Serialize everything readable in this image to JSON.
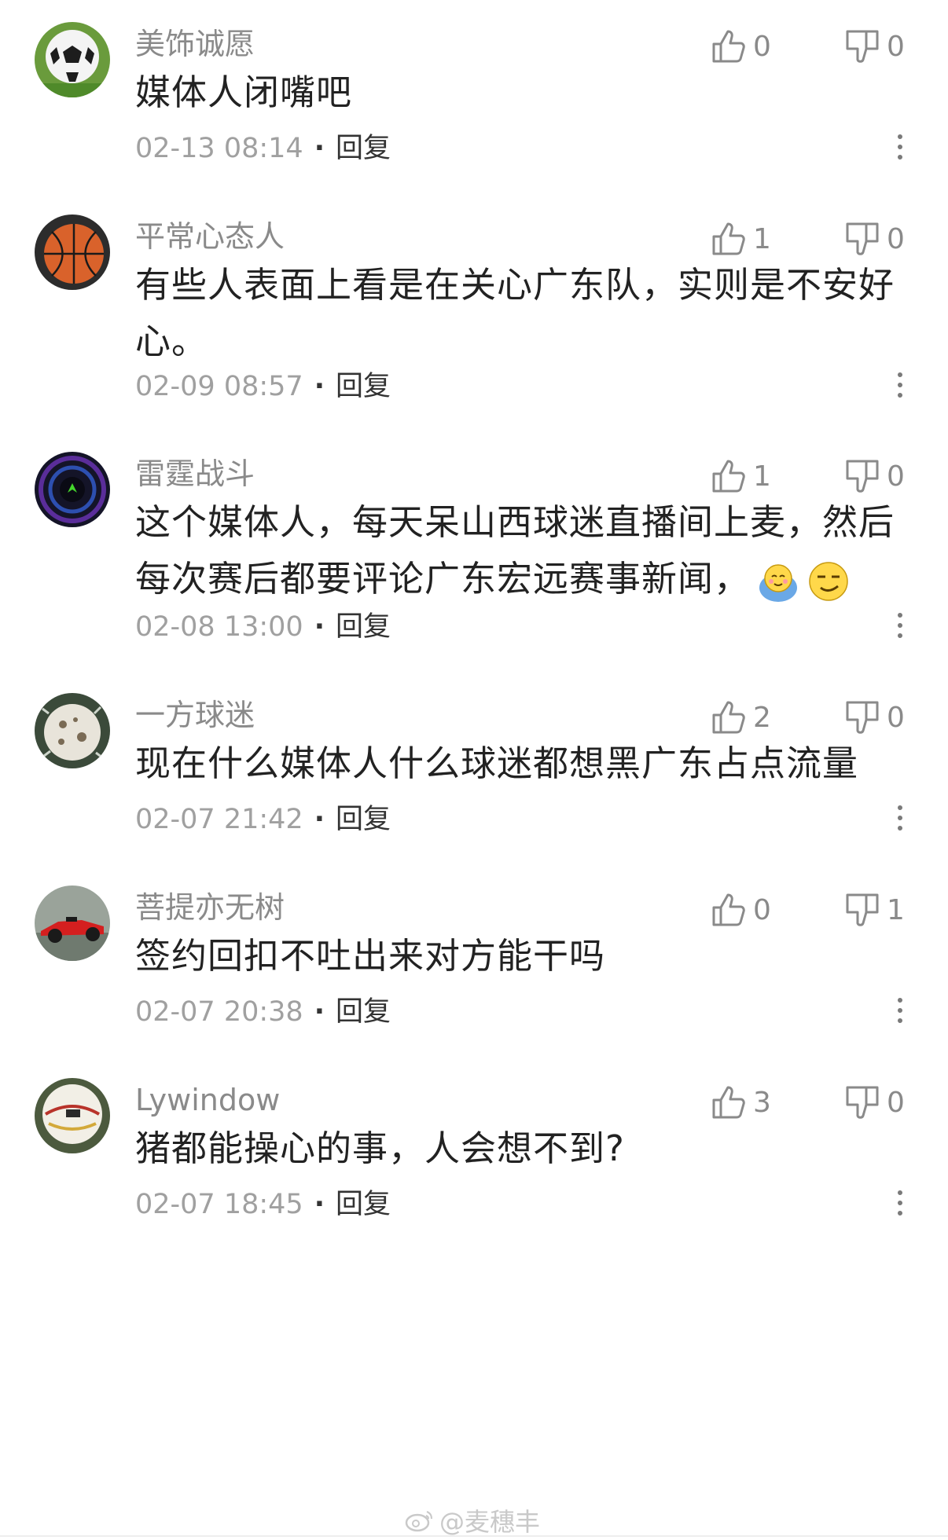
{
  "comments": [
    {
      "username": "美饰诚愿",
      "likes": "0",
      "dislikes": "0",
      "text": "媒体人闭嘴吧",
      "time": "02-13 08:14",
      "reply": "回复",
      "avatar": "soccer-ball"
    },
    {
      "username": "平常心态人",
      "likes": "1",
      "dislikes": "0",
      "text": "有些人表面上看是在关心广东队，实则是不安好心。",
      "time": "02-09 08:57",
      "reply": "回复",
      "avatar": "basketball"
    },
    {
      "username": "雷霆战斗",
      "likes": "1",
      "dislikes": "0",
      "text": "这个媒体人，每天呆山西球迷直播间上麦，然后每次赛后都要评论广东宏远赛事新闻，",
      "time": "02-08 13:00",
      "reply": "回复",
      "avatar": "razer-logo",
      "emojis": [
        "shy-emoji",
        "smirk-emoji"
      ]
    },
    {
      "username": "一方球迷",
      "likes": "2",
      "dislikes": "0",
      "text": "现在什么媒体人什么球迷都想黑广东占点流量",
      "time": "02-07 21:42",
      "reply": "回复",
      "avatar": "splash-ball"
    },
    {
      "username": "菩提亦无树",
      "likes": "0",
      "dislikes": "1",
      "text": "签约回扣不吐出来对方能干吗",
      "time": "02-07 20:38",
      "reply": "回复",
      "avatar": "race-car"
    },
    {
      "username": "Lywindow",
      "likes": "3",
      "dislikes": "0",
      "text": "猪都能操心的事，人会想不到?",
      "time": "02-07 18:45",
      "reply": "回复",
      "avatar": "white-ball"
    }
  ],
  "watermark": "@麦穗丰"
}
